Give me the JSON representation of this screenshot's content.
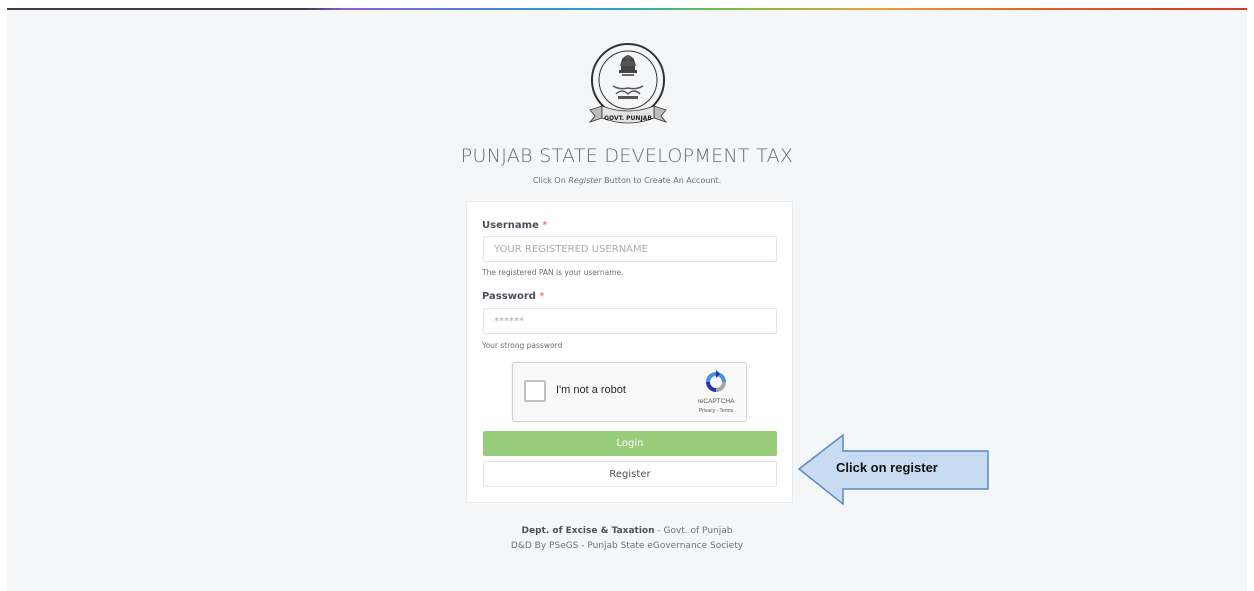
{
  "header": {
    "title": "PUNJAB STATE DEVELOPMENT TAX",
    "subtitle_prefix": "Click On ",
    "subtitle_emphasis": "Register",
    "subtitle_suffix": " Button to Create An Account."
  },
  "emblem": {
    "ribbon_text": "GOVT. PUNJAB"
  },
  "form": {
    "username": {
      "label": "Username",
      "required_mark": "*",
      "placeholder": "YOUR REGISTERED USERNAME",
      "value": "",
      "help": "The registered PAN is your username."
    },
    "password": {
      "label": "Password",
      "required_mark": "*",
      "placeholder": "******",
      "value": "",
      "help": "Your strong password"
    },
    "recaptcha": {
      "checkbox_label": "I'm not a robot",
      "brand": "reCAPTCHA",
      "terms": "Privacy - Terms"
    },
    "login_label": "Login",
    "register_label": "Register"
  },
  "callout": {
    "text": "Click on register"
  },
  "footer": {
    "dept": "Dept. of Excise & Taxation",
    "dept_suffix": " - Govt. of Punjab",
    "credit": "D&D By PSeGS - Punjab State eGovernance Society"
  },
  "colors": {
    "login_button": "#97cc7a",
    "callout_fill": "#c7dcf1",
    "callout_border": "#5a88c6",
    "required": "#e2574c"
  }
}
